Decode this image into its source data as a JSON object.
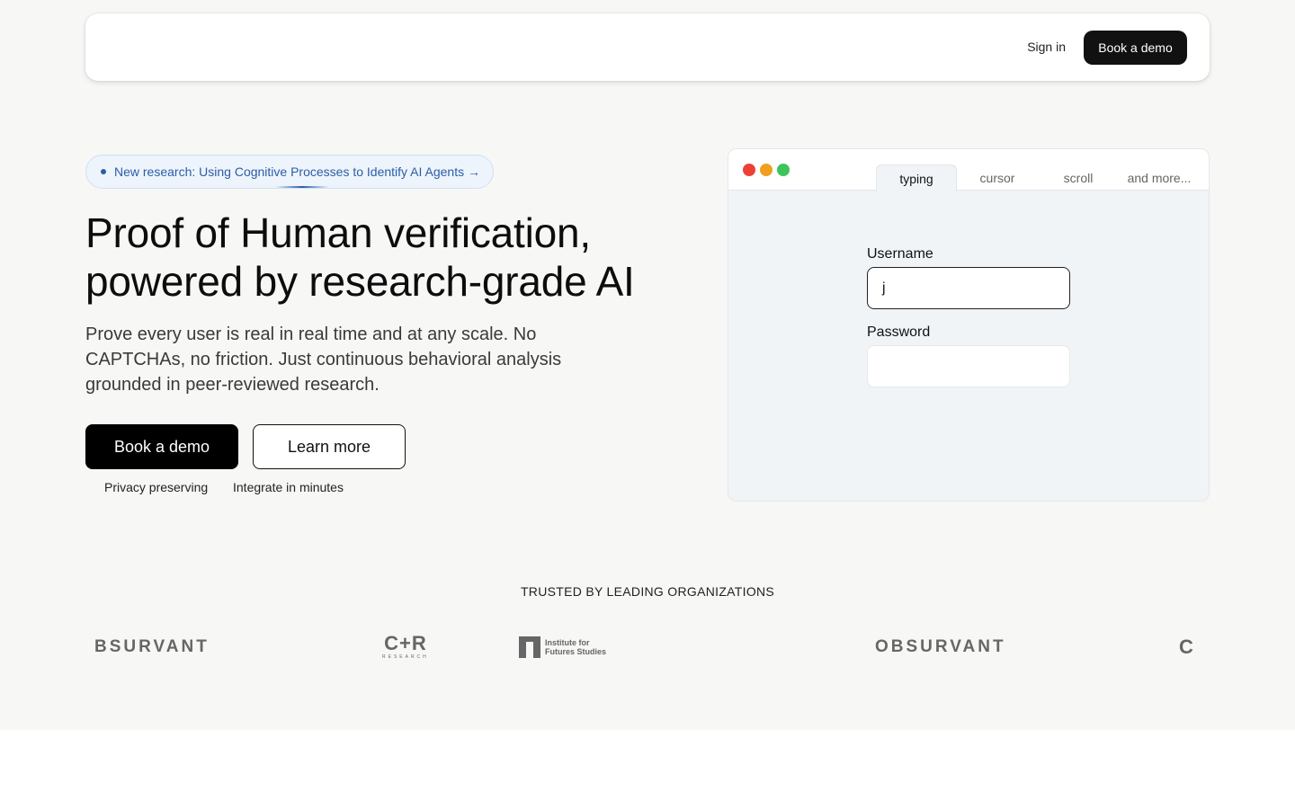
{
  "nav": {
    "sign_in": "Sign in",
    "book_demo": "Book a demo"
  },
  "hero": {
    "pill_text": "New research: Using Cognitive Processes to Identify AI Agents →",
    "title_line1": "Proof of Human verification,",
    "title_line2": "powered by research-grade AI",
    "subtitle": "Prove every user is real in real time and at any scale. No CAPTCHAs, no friction. Just continuous behavioral analysis grounded in peer-reviewed research.",
    "primary_button": "Book a demo",
    "secondary_button": "Learn more",
    "features": [
      "Privacy preserving",
      "Integrate in minutes"
    ]
  },
  "demo": {
    "tabs": [
      "typing",
      "cursor",
      "scroll",
      "and more..."
    ],
    "active_tab": "typing",
    "username_label": "Username",
    "username_value": "j",
    "password_label": "Password",
    "password_value": ""
  },
  "trusted": {
    "heading": "TRUSTED BY LEADING ORGANIZATIONS",
    "logos": [
      {
        "name": "OBSURVANT",
        "text": "BSURVANT"
      },
      {
        "name": "C+R Research",
        "text": "C+R",
        "sub": "RESEARCH"
      },
      {
        "name": "Institute for Futures Studies",
        "line1": "Institute for",
        "line2": "Futures Studies"
      },
      {
        "name": "OBSURVANT",
        "text": "OBSURVANT"
      },
      {
        "name": "C+R Research",
        "text": "C"
      }
    ]
  },
  "colors": {
    "background": "#f7f7f5",
    "primary": "#000000",
    "accent_blue": "#2a5ea8",
    "traffic_red": "#ee4035",
    "traffic_yellow": "#f0a020",
    "traffic_green": "#3cc45a"
  }
}
